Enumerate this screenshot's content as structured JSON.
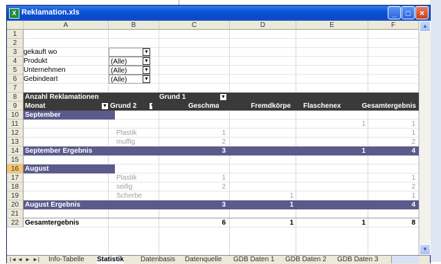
{
  "window": {
    "title": "Reklamation.xls",
    "minimize": "_",
    "maximize": "□",
    "close": "×"
  },
  "columns": [
    "A",
    "B",
    "C",
    "D",
    "E",
    "F"
  ],
  "rows": [
    "1",
    "2",
    "3",
    "4",
    "5",
    "6",
    "7",
    "8",
    "9",
    "10",
    "11",
    "12",
    "13",
    "14",
    "15",
    "16",
    "17",
    "18",
    "19",
    "20",
    "21",
    "22"
  ],
  "selected_row": "16",
  "page_fields": [
    {
      "label": "gekauft wo",
      "value": ""
    },
    {
      "label": "Produkt",
      "value": "(Alle)"
    },
    {
      "label": "Unternehmen",
      "value": "(Alle)"
    },
    {
      "label": "Gebindeart",
      "value": "(Alle)"
    }
  ],
  "pivot": {
    "data_field": "Anzahl Reklamationen",
    "column_field": "Grund 1",
    "row_field_1": "Monat",
    "row_field_2": "Grund 2",
    "column_headers": [
      "Geschmack",
      "Fremdkörper",
      "Flaschenexplosion",
      "Gesamtergebnis"
    ],
    "groups": [
      {
        "name": "September",
        "rows": [
          {
            "g2": "",
            "geschmack": "",
            "fremd": "",
            "flasche": "1",
            "gesamt": "1"
          },
          {
            "g2": "Plastik",
            "geschmack": "1",
            "fremd": "",
            "flasche": "",
            "gesamt": "1"
          },
          {
            "g2": "muffig",
            "geschmack": "2",
            "fremd": "",
            "flasche": "",
            "gesamt": "2"
          }
        ],
        "total_label": "September Ergebnis",
        "total": {
          "geschmack": "3",
          "fremd": "",
          "flasche": "1",
          "gesamt": "4"
        }
      },
      {
        "name": "August",
        "rows": [
          {
            "g2": "Plastik",
            "geschmack": "1",
            "fremd": "",
            "flasche": "",
            "gesamt": "1"
          },
          {
            "g2": "seifig",
            "geschmack": "2",
            "fremd": "",
            "flasche": "",
            "gesamt": "2"
          },
          {
            "g2": "Scherbe",
            "geschmack": "",
            "fremd": "1",
            "flasche": "",
            "gesamt": "1"
          }
        ],
        "total_label": "August Ergebnis",
        "total": {
          "geschmack": "3",
          "fremd": "1",
          "flasche": "",
          "gesamt": "4"
        }
      }
    ],
    "grand_total_label": "Gesamtergebnis",
    "grand_total": {
      "geschmack": "6",
      "fremd": "1",
      "flasche": "1",
      "gesamt": "8"
    }
  },
  "sheet_tabs": [
    "Info-Tabelle",
    "Statistik",
    "Datenbasis",
    "Datenquelle",
    "GDB Daten 1",
    "GDB Daten 2",
    "GDB Daten 3"
  ],
  "active_tab": "Statistik",
  "nav_buttons": [
    "|◄",
    "◄",
    "►",
    "►|"
  ],
  "dropdown_glyph": "▼",
  "colors": {
    "pivot_dark": "#3a3a3a",
    "pivot_lila": "#5a5a8c",
    "title_blue": "#0a53d8",
    "selected_row_header": "#f7c66b"
  }
}
